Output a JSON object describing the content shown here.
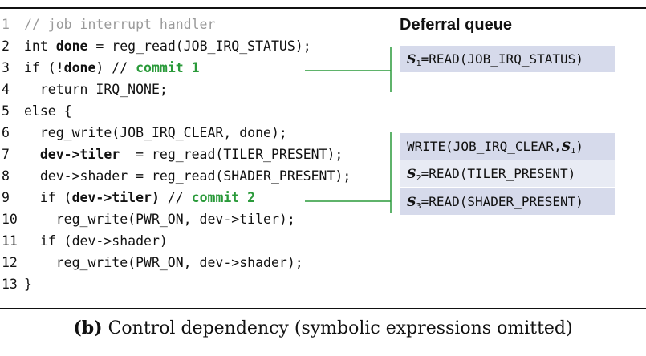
{
  "code": {
    "lines": [
      {
        "n": "1",
        "parts": [
          {
            "t": "// job interrupt handler",
            "c": "cmt"
          }
        ],
        "faded": true
      },
      {
        "n": "2",
        "parts": [
          {
            "t": "int "
          },
          {
            "t": "done",
            "c": "kw"
          },
          {
            "t": " = reg_read(JOB_IRQ_STATUS);"
          }
        ]
      },
      {
        "n": "3",
        "parts": [
          {
            "t": "if (!"
          },
          {
            "t": "done",
            "c": "kw"
          },
          {
            "t": ") // "
          },
          {
            "t": "commit 1",
            "c": "commit"
          }
        ]
      },
      {
        "n": "4",
        "parts": [
          {
            "t": "  return IRQ_NONE;"
          }
        ]
      },
      {
        "n": "5",
        "parts": [
          {
            "t": "else {"
          }
        ]
      },
      {
        "n": "6",
        "parts": [
          {
            "t": "  reg_write(JOB_IRQ_CLEAR, done);"
          }
        ]
      },
      {
        "n": "7",
        "parts": [
          {
            "t": "  "
          },
          {
            "t": "dev->tiler",
            "c": "kw"
          },
          {
            "t": "  = reg_read(TILER_PRESENT);"
          }
        ]
      },
      {
        "n": "8",
        "parts": [
          {
            "t": "  dev->shader = reg_read(SHADER_PRESENT);"
          }
        ]
      },
      {
        "n": "9",
        "parts": [
          {
            "t": "  if ("
          },
          {
            "t": "dev->tiler)",
            "c": "kw"
          },
          {
            "t": " // "
          },
          {
            "t": "commit 2",
            "c": "commit"
          }
        ]
      },
      {
        "n": "10",
        "parts": [
          {
            "t": "    reg_write(PWR_ON, dev->tiler);"
          }
        ]
      },
      {
        "n": "11",
        "parts": [
          {
            "t": "  if (dev->shader)"
          }
        ]
      },
      {
        "n": "12",
        "parts": [
          {
            "t": "    reg_write(PWR_ON, dev->shader);"
          }
        ]
      },
      {
        "n": "13",
        "parts": [
          {
            "t": "}"
          }
        ]
      }
    ]
  },
  "queue": {
    "title": "Deferral queue",
    "group1": [
      {
        "sym": "S",
        "sub": "1",
        "text": "=READ(JOB_IRQ_STATUS)"
      }
    ],
    "group2": [
      {
        "prefix": "WRITE(JOB_IRQ_CLEAR,",
        "sym": "S",
        "sub": "1",
        "suffix": ")"
      },
      {
        "sym": "S",
        "sub": "2",
        "text": "=READ(TILER_PRESENT)"
      },
      {
        "sym": "S",
        "sub": "3",
        "text": "=READ(SHADER_PRESENT)"
      }
    ]
  },
  "caption": {
    "label": "(b)",
    "text": " Control dependency (symbolic expressions omitted)"
  },
  "colors": {
    "commit": "#2a9a3a",
    "entry": "#d6daeb",
    "connector": "#2a9a3a"
  }
}
